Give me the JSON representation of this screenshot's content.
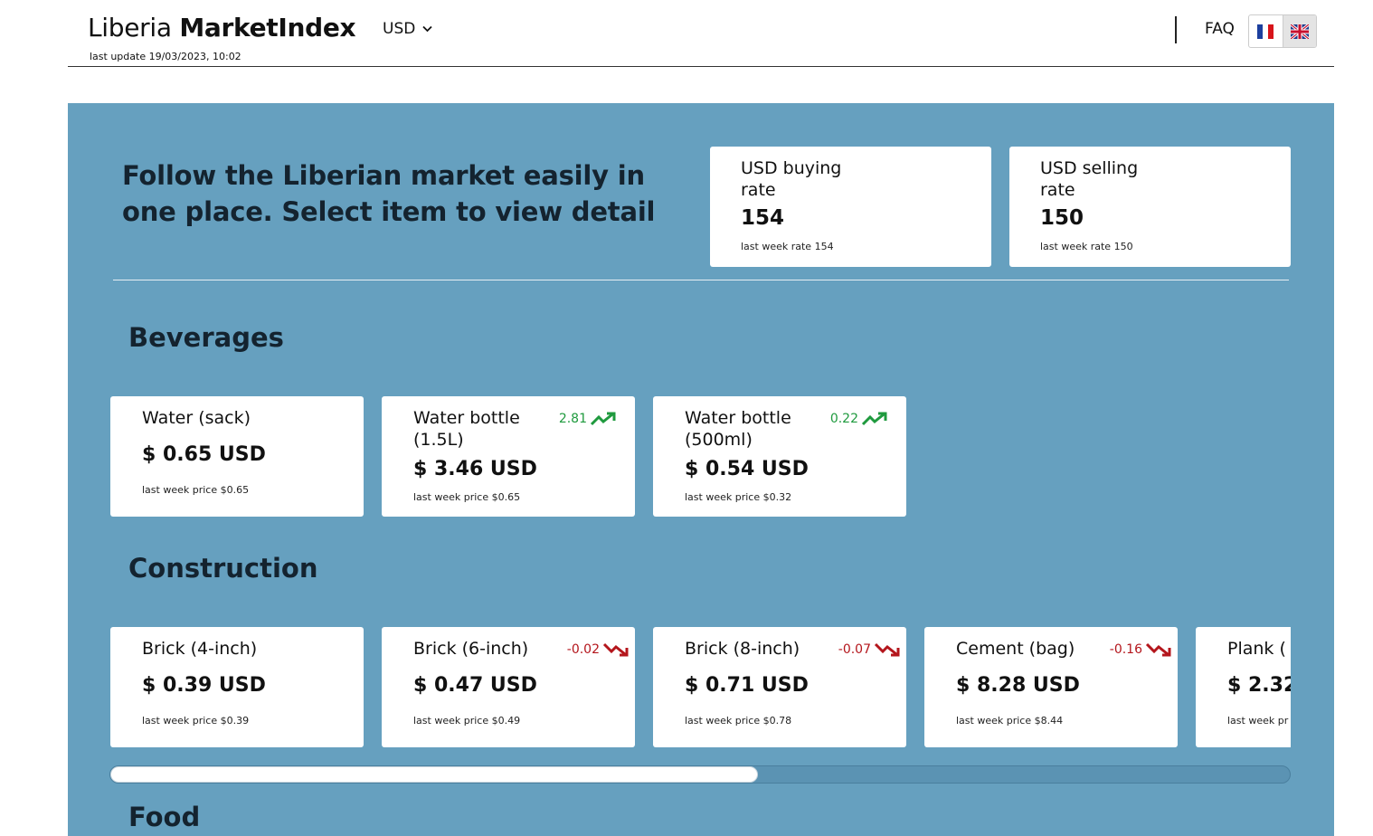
{
  "header": {
    "brand_light": "Liberia ",
    "brand_bold": "MarketIndex",
    "last_update": "last update 19/03/2023, 10:02",
    "currency": "USD",
    "faq": "FAQ",
    "languages": [
      {
        "icon": "france-flag-icon",
        "active": false
      },
      {
        "icon": "uk-flag-icon",
        "active": true
      }
    ]
  },
  "intro": "Follow the Liberian market easily in one place. Select item to view detail",
  "rates": [
    {
      "title": "USD buying rate",
      "value": "154",
      "last": "last week rate 154"
    },
    {
      "title": "USD selling rate",
      "value": "150",
      "last": "last week rate 150"
    }
  ],
  "sections": [
    {
      "title": "Beverages",
      "items": [
        {
          "name": "Water (sack)",
          "price": "$ 0.65 USD",
          "last": "last week price $0.65",
          "change": "",
          "trend": ""
        },
        {
          "name": "Water bottle (1.5L)",
          "price": "$ 3.46 USD",
          "last": "last week price $0.65",
          "change": "2.81",
          "trend": "up"
        },
        {
          "name": "Water bottle (500ml)",
          "price": "$ 0.54 USD",
          "last": "last week price $0.32",
          "change": "0.22",
          "trend": "up"
        }
      ]
    },
    {
      "title": "Construction",
      "items": [
        {
          "name": "Brick (4-inch)",
          "price": "$ 0.39 USD",
          "last": "last week price $0.39",
          "change": "",
          "trend": ""
        },
        {
          "name": "Brick (6-inch)",
          "price": "$ 0.47 USD",
          "last": "last week price $0.49",
          "change": "-0.02",
          "trend": "down"
        },
        {
          "name": "Brick (8-inch)",
          "price": "$ 0.71 USD",
          "last": "last week price $0.78",
          "change": "-0.07",
          "trend": "down"
        },
        {
          "name": "Cement (bag)",
          "price": "$ 8.28 USD",
          "last": "last week price $8.44",
          "change": "-0.16",
          "trend": "down"
        },
        {
          "name": "Plank (",
          "price": "$ 2.32",
          "last": "last week pr",
          "change": "",
          "trend": ""
        }
      ]
    },
    {
      "title": "Food"
    }
  ],
  "colors": {
    "accent_bg": "#66a0bf",
    "up": "#1f9a3e",
    "down": "#b4161c"
  }
}
